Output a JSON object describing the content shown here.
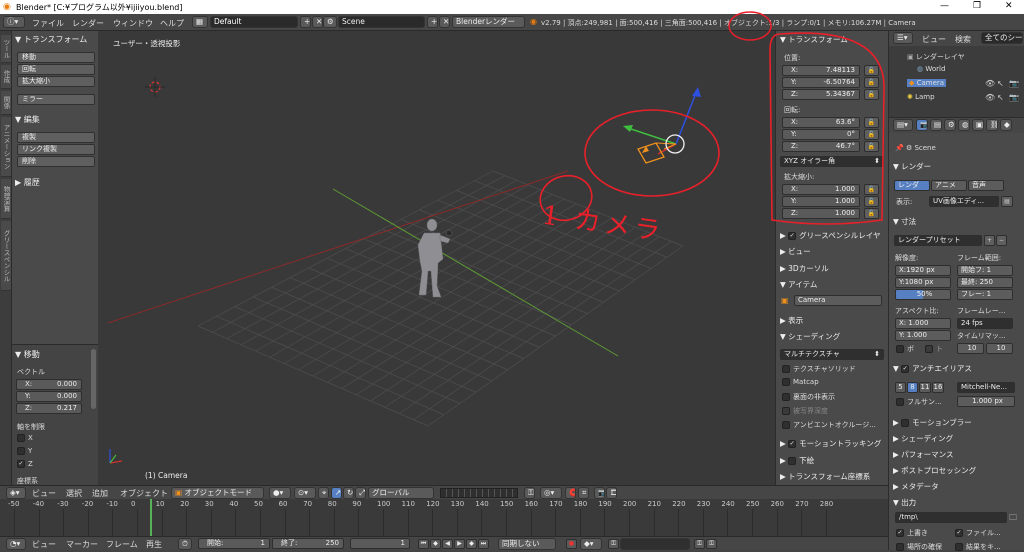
{
  "window": {
    "title": "Blender* [C:¥プログラム以外¥ijiiyou.blend]",
    "minimize": "—",
    "maximize": "❐",
    "close": "✕"
  },
  "info": {
    "menus": [
      "ファイル",
      "レンダー",
      "ウィンドウ",
      "ヘルプ"
    ],
    "layout": "Default",
    "scene": "Scene",
    "engine": "Blenderレンダー",
    "stats": "v2.79 | 頂点:249,981 | 面:500,416 | 三角面:500,416 | オブジェクト:1/3 | ランプ:0/1 | メモリ:106.27M | Camera"
  },
  "left_tabs": [
    "ツール",
    "作成",
    "関係",
    "アニメーション",
    "物理演算",
    "グリースペンシル"
  ],
  "tool_panel": {
    "transform_header": "トランスフォーム",
    "transform_buttons": [
      "移動",
      "回転",
      "拡大縮小",
      "ミラー"
    ],
    "edit_header": "編集",
    "edit_buttons": [
      "複製",
      "リンク複製",
      "削除"
    ],
    "history_header": "履歴",
    "move_header": "移動",
    "vector_label": "ベクトル",
    "vector": [
      {
        "axis": "X:",
        "value": "0.000"
      },
      {
        "axis": "Y:",
        "value": "0.000"
      },
      {
        "axis": "Z:",
        "value": "0.217"
      }
    ],
    "constraint_label": "軸を制限",
    "constraint_axes": [
      {
        "label": "X",
        "checked": false
      },
      {
        "label": "Y",
        "checked": false
      },
      {
        "label": "Z",
        "checked": true
      }
    ],
    "cut_label": "座標系"
  },
  "viewport": {
    "view_label": "ユーザー・透視投影",
    "object_label": "(1) Camera",
    "annotation_1": "1 カメラ",
    "annotation_2": "2"
  },
  "npanel": {
    "transform_header": "トランスフォーム",
    "location_label": "位置:",
    "location": [
      {
        "axis": "X:",
        "value": "7.48113"
      },
      {
        "axis": "Y:",
        "value": "-6.50764"
      },
      {
        "axis": "Z:",
        "value": "5.34367"
      }
    ],
    "rotation_label": "回転:",
    "rotation": [
      {
        "axis": "X:",
        "value": "63.6°"
      },
      {
        "axis": "Y:",
        "value": "0°"
      },
      {
        "axis": "Z:",
        "value": "46.7°"
      }
    ],
    "rotation_mode": "XYZ オイラー角",
    "scale_label": "拡大縮小:",
    "scale": [
      {
        "axis": "X:",
        "value": "1.000"
      },
      {
        "axis": "Y:",
        "value": "1.000"
      },
      {
        "axis": "Z:",
        "value": "1.000"
      }
    ],
    "grease_pencil": "グリースペンシルレイヤ",
    "view": "ビュー",
    "cursor": "3Dカーソル",
    "item": "アイテム",
    "item_name": "Camera",
    "display": "表示",
    "shading": "シェーディング",
    "shading_mode": "マルチテクスチャ",
    "shading_options": [
      "テクスチャソリッド",
      "Matcap",
      "裏面の非表示",
      "被写界深度",
      "アンビエントオクルージ..."
    ],
    "motion_tracking": "モーショントラッキング",
    "background": "下絵",
    "orientation": "トランスフォーム座標系"
  },
  "outliner": {
    "view": "ビュー",
    "search": "検索",
    "filter": "全てのシーン",
    "items": [
      "レンダーレイヤ",
      "World",
      "Camera",
      "Lamp"
    ]
  },
  "properties": {
    "scene": "Scene",
    "render_header": "レンダー",
    "render_buttons": [
      "レンダ",
      "アニメ",
      "音声"
    ],
    "display_label": "表示:",
    "display_value": "UV画像エディ...",
    "dimensions_header": "寸法",
    "preset": "レンダープリセット",
    "resolution_label": "解像度:",
    "frame_range_label": "フレーム範囲:",
    "res_x": "X:1920 px",
    "res_y": "Y:1080 px",
    "res_pct": "50%",
    "frame_start": "開始フ: 1",
    "frame_end": "最終: 250",
    "frame_step": "フレー: 1",
    "aspect_label": "アスペクト比:",
    "framerate_label": "フレームレー...",
    "aspect_x": "X: 1.000",
    "aspect_y": "Y: 1.000",
    "fps": "24 fps",
    "time_remap": "タイムリマッ...",
    "remap_old": "10",
    "remap_new": "10",
    "border": "ボ",
    "crop": "ト",
    "aa_header": "アンチエイリアス",
    "aa_samples": [
      "5",
      "8",
      "11",
      "16"
    ],
    "aa_filter": "Mitchell-Ne...",
    "full_sample": "フルサン...",
    "filter_size": "1.000 px",
    "sections": [
      "モーションブラー",
      "シェーディング",
      "パフォーマンス",
      "ポストプロセッシング",
      "メタデータ",
      "出力"
    ],
    "output_path": "/tmp\\",
    "overwrite": "上書き",
    "file_ext": "ファイル...",
    "placeholders": "場所の確保",
    "cache": "結果をキ..."
  },
  "view3d_header": {
    "menus": [
      "ビュー",
      "選択",
      "追加",
      "オブジェクト"
    ],
    "mode": "オブジェクトモード",
    "orientation": "グローバル"
  },
  "timeline": {
    "ticks": [
      "-50",
      "-40",
      "-30",
      "-20",
      "-10",
      "0",
      "10",
      "20",
      "30",
      "40",
      "50",
      "60",
      "70",
      "80",
      "90",
      "100",
      "110",
      "120",
      "130",
      "140",
      "150",
      "160",
      "170",
      "180",
      "190",
      "200",
      "210",
      "220",
      "230",
      "240",
      "250",
      "260",
      "270",
      "280"
    ],
    "menus": [
      "ビュー",
      "マーカー",
      "フレーム",
      "再生"
    ],
    "start": "開始:",
    "start_val": "1",
    "end": "終了:",
    "end_val": "250",
    "current": "1",
    "sync": "同期しない"
  },
  "colors": {
    "annotation": "#e8202a",
    "accent": "#5680c2",
    "x_axis": "#8a2a2a",
    "y_axis": "#5e9a34"
  }
}
